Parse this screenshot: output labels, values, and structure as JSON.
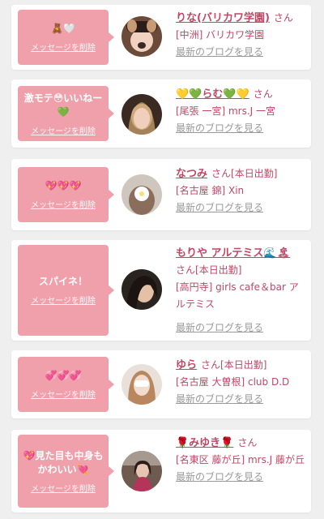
{
  "delete_label": "メッセージを削除",
  "blog_label": "最新のブログを見る",
  "san": "さん",
  "items": [
    {
      "message": "🧸🤍",
      "name": "りな(バリカワ学園)",
      "status": "",
      "shop": "[中洲] バリカワ学園"
    },
    {
      "message": "激モテ😳いいねー💚",
      "name": "💛💚らむ💚💛",
      "status": "",
      "shop": "[尾張 一宮] mrs.J 一宮"
    },
    {
      "message": "💖💖💖",
      "name": "なつみ",
      "status": "[本日出勤]",
      "shop": "[名古屋 錦] Xin"
    },
    {
      "message": "スパイネ！",
      "name": "もりや アルテミス🌊🏝",
      "status": "[本日出勤]",
      "shop": "[高円寺] girls cafe＆bar アルテミス"
    },
    {
      "message": "💞💞💞",
      "name": "ゆら",
      "status": "[本日出勤]",
      "shop": "[名古屋 大曽根] club D.D"
    },
    {
      "message": "💖見た目も中身もかわいい💘",
      "name": "🌹みゆき🌹",
      "status": "",
      "shop": "[名東区 藤が丘] mrs.J 藤が丘"
    }
  ],
  "colors": {
    "bubble": "#f0a0ab",
    "accent": "#c14766",
    "muted": "#9a9a9a",
    "background": "#efefef"
  }
}
